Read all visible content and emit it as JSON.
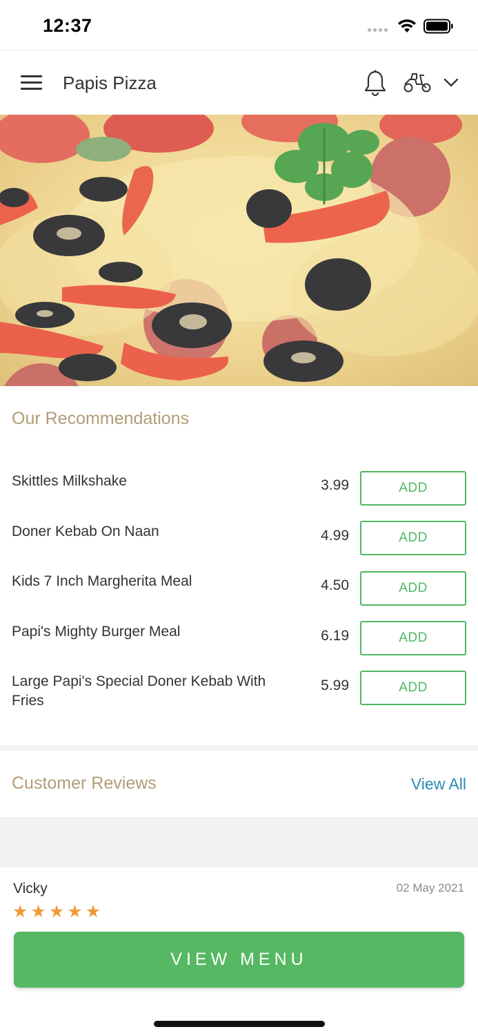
{
  "status_bar": {
    "time": "12:37"
  },
  "header": {
    "title": "Papis Pizza",
    "menu_icon": "hamburger-icon",
    "bell_icon": "bell-icon",
    "delivery_icon": "scooter-icon",
    "dropdown_icon": "chevron-down-icon"
  },
  "hero": {
    "description_icon": "pizza-photo"
  },
  "recommendations": {
    "title": "Our Recommendations",
    "add_label": "ADD",
    "items": [
      {
        "name": "Skittles Milkshake",
        "price": "3.99"
      },
      {
        "name": "Doner Kebab On Naan",
        "price": "4.99"
      },
      {
        "name": "Kids 7 Inch Margherita Meal",
        "price": "4.50"
      },
      {
        "name": "Papi's Mighty Burger Meal",
        "price": "6.19"
      },
      {
        "name": "Large Papi's Special Doner Kebab With Fries",
        "price": "5.99"
      }
    ]
  },
  "reviews": {
    "title": "Customer Reviews",
    "view_all": "View All",
    "items": [
      {
        "name": "Vicky",
        "date": "02 May 2021",
        "rating": 5
      }
    ]
  },
  "cta": {
    "label": "VIEW MENU"
  },
  "colors": {
    "accent_green": "#56b862",
    "section_title": "#b19d76",
    "link_blue": "#2a8ab8",
    "star_orange": "#f09a3a"
  }
}
